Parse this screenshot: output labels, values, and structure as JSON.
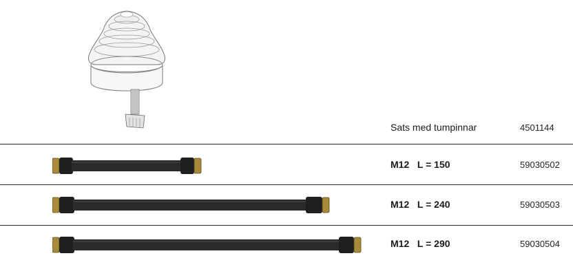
{
  "products": [
    {
      "description": "Sats med tumpinnar",
      "part_number": "4501144",
      "image": "joystick-handle-icon"
    },
    {
      "thread": "M12",
      "length": "L = 150",
      "part_number": "59030502",
      "image": "flexible-hose-icon"
    },
    {
      "thread": "M12",
      "length": "L = 240",
      "part_number": "59030503",
      "image": "flexible-hose-icon"
    },
    {
      "thread": "M12",
      "length": "L = 290",
      "part_number": "59030504",
      "image": "flexible-hose-icon"
    }
  ]
}
